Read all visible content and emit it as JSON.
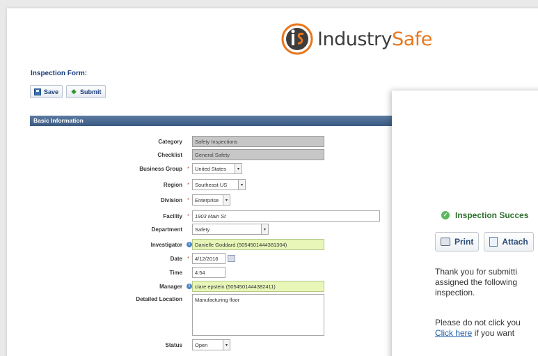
{
  "brand": {
    "name_part1": "Industry",
    "name_part2": "Safe",
    "primary_color": "#3d3d3d",
    "accent_color": "#e8771e"
  },
  "form": {
    "title": "Inspection Form:",
    "toolbar": {
      "save_label": "Save",
      "submit_label": "Submit"
    },
    "section_title": "Basic Information",
    "fields": {
      "category": {
        "label": "Category",
        "value": "Safety Inspections"
      },
      "checklist": {
        "label": "Checklist",
        "value": "General Safety"
      },
      "business_group": {
        "label": "Business Group",
        "value": "United States"
      },
      "region": {
        "label": "Region",
        "value": "Southeast US"
      },
      "division": {
        "label": "Division",
        "value": "Enterprise"
      },
      "facility": {
        "label": "Facility",
        "value": "1903 Main St"
      },
      "department": {
        "label": "Department",
        "value": "Safety"
      },
      "investigator": {
        "label": "Investigator",
        "value": "Danielle Goddard (5054501444381304)"
      },
      "date": {
        "label": "Date",
        "value": "4/12/2016"
      },
      "time": {
        "label": "Time",
        "value": "4:54"
      },
      "manager": {
        "label": "Manager",
        "value": "clare epstein (5054501444382411)"
      },
      "detailed_location": {
        "label": "Detailed Location",
        "value": "Manufacturing floor"
      },
      "status": {
        "label": "Status",
        "value": "Open"
      }
    },
    "required_marker": "*"
  },
  "modal": {
    "success_text": "Inspection Succes",
    "print_label": "Print",
    "attach_label": "Attach",
    "message_line1": "Thank you for submitti",
    "message_line2": "assigned the following",
    "message_line3": "inspection.",
    "message_line4": "Please do not click you",
    "link_text": "Click here",
    "message_line5_rest": " if you want "
  }
}
